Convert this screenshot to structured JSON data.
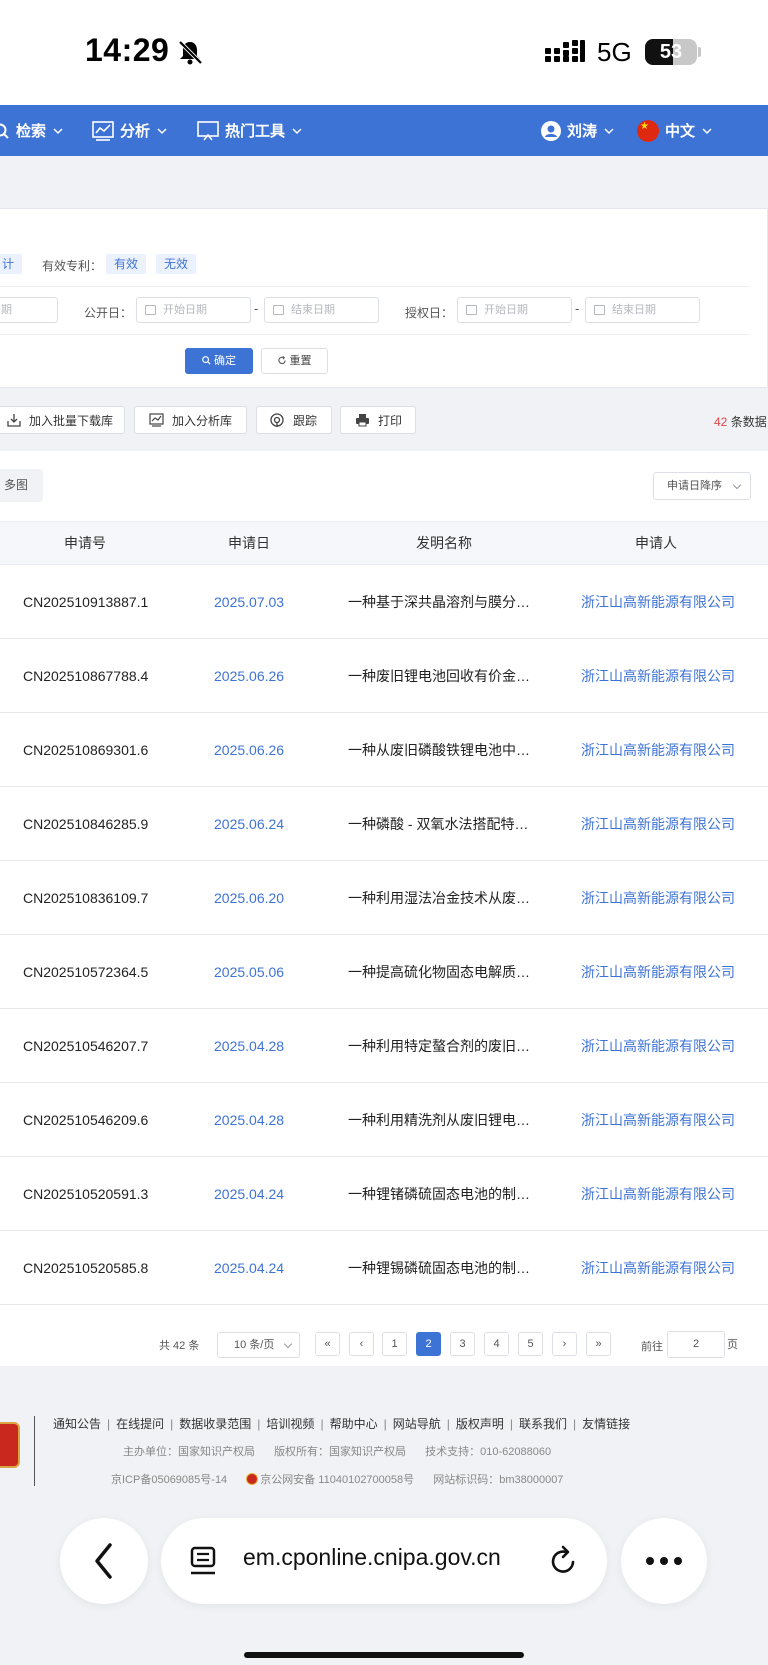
{
  "status_bar": {
    "time": "14:29",
    "network": "5G",
    "battery": "53",
    "battery_level": 0.53
  },
  "nav": {
    "items": [
      {
        "label": "检索",
        "icon": "search-icon"
      },
      {
        "label": "分析",
        "icon": "analysis-icon"
      },
      {
        "label": "热门工具",
        "icon": "tools-icon"
      }
    ],
    "user": "刘涛",
    "language": "中文"
  },
  "filters": {
    "partial_label": "计",
    "valid_label": "有效专利：",
    "valid_options": [
      "有效",
      "无效"
    ],
    "partial_date": "期",
    "pub_date_label": "公开日：",
    "grant_date_label": "授权日：",
    "start_placeholder": "开始日期",
    "end_placeholder": "结束日期",
    "range_sep": "-",
    "confirm": "确定",
    "reset": "重置"
  },
  "toolbar": {
    "batch_download": "加入批量下载库",
    "analysis_lib": "加入分析库",
    "track": "跟踪",
    "print": "打印",
    "count_num": "42",
    "count_text": "条数据"
  },
  "view": {
    "multi_image": "多图",
    "sort": "申请日降序"
  },
  "table": {
    "headers": [
      "申请号",
      "申请日",
      "发明名称",
      "申请人"
    ],
    "rows": [
      {
        "no": "CN202510913887.1",
        "date": "2025.07.03",
        "title": "一种基于深共晶溶剂与膜分…",
        "applicant": "浙江山高新能源有限公司"
      },
      {
        "no": "CN202510867788.4",
        "date": "2025.06.26",
        "title": "一种废旧锂电池回收有价金…",
        "applicant": "浙江山高新能源有限公司"
      },
      {
        "no": "CN202510869301.6",
        "date": "2025.06.26",
        "title": "一种从废旧磷酸铁锂电池中…",
        "applicant": "浙江山高新能源有限公司"
      },
      {
        "no": "CN202510846285.9",
        "date": "2025.06.24",
        "title": "一种磷酸 - 双氧水法搭配特…",
        "applicant": "浙江山高新能源有限公司"
      },
      {
        "no": "CN202510836109.7",
        "date": "2025.06.20",
        "title": "一种利用湿法冶金技术从废…",
        "applicant": "浙江山高新能源有限公司"
      },
      {
        "no": "CN202510572364.5",
        "date": "2025.05.06",
        "title": "一种提高硫化物固态电解质…",
        "applicant": "浙江山高新能源有限公司"
      },
      {
        "no": "CN202510546207.7",
        "date": "2025.04.28",
        "title": "一种利用特定螯合剂的废旧…",
        "applicant": "浙江山高新能源有限公司"
      },
      {
        "no": "CN202510546209.6",
        "date": "2025.04.28",
        "title": "一种利用精洗剂从废旧锂电…",
        "applicant": "浙江山高新能源有限公司"
      },
      {
        "no": "CN202510520591.3",
        "date": "2025.04.24",
        "title": "一种锂锗磷硫固态电池的制…",
        "applicant": "浙江山高新能源有限公司"
      },
      {
        "no": "CN202510520585.8",
        "date": "2025.04.24",
        "title": "一种锂锡磷硫固态电池的制…",
        "applicant": "浙江山高新能源有限公司"
      }
    ]
  },
  "pagination": {
    "total": "共 42 条",
    "page_size": "10 条/页",
    "pages": [
      "1",
      "2",
      "3",
      "4",
      "5"
    ],
    "current": "2",
    "first": "«",
    "prev": "‹",
    "next": "›",
    "last": "»",
    "goto_label": "前往",
    "goto_value": "2",
    "goto_unit": "页"
  },
  "footer": {
    "links": [
      "通知公告",
      "在线提问",
      "数据收录范围",
      "培训视频",
      "帮助中心",
      "网站导航",
      "版权声明",
      "联系我们",
      "友情链接"
    ],
    "sponsor": "主办单位：国家知识产权局",
    "copyright": "版权所有：国家知识产权局",
    "support": "技术支持：010-62088060",
    "icp": "京ICP备05069085号-14",
    "police": "京公网安备 11040102700058号",
    "site_id": "网站标识码：bm38000007"
  },
  "browser": {
    "url": "em.cponline.cnipa.gov.cn"
  }
}
